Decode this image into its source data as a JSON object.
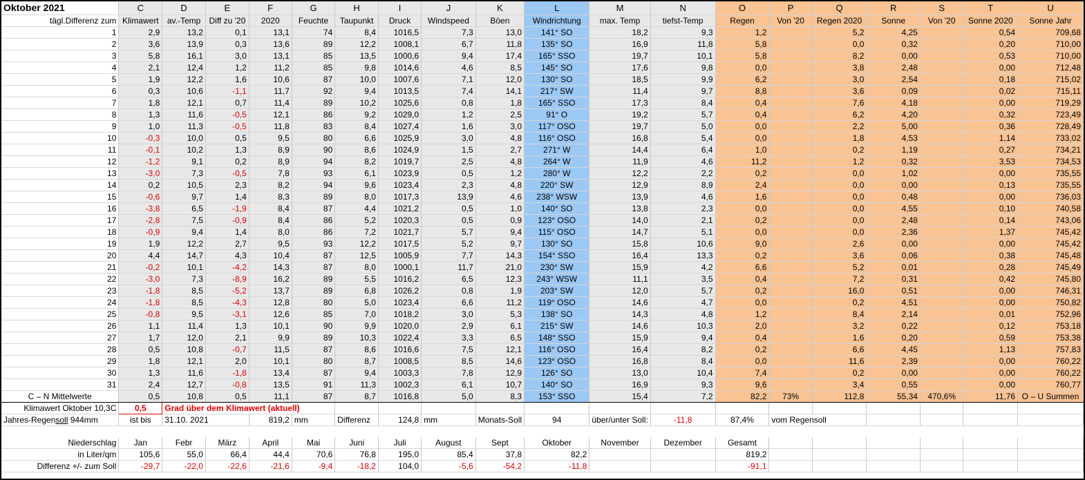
{
  "sheet": {
    "title": "Oktober 2021",
    "col_letters": [
      "C",
      "D",
      "E",
      "F",
      "G",
      "H",
      "I",
      "J",
      "K",
      "L",
      "M",
      "N",
      "O",
      "P",
      "Q",
      "R",
      "S",
      "T",
      "U"
    ],
    "row_label_header": "tägl.Differenz zum",
    "headers": [
      "Klimawert",
      "av.-Temp",
      "Diff zu '20",
      "2020",
      "Feuchte",
      "Taupunkt",
      "Druck",
      "Windspeed",
      "Böen",
      "Windrichtung",
      "max. Temp",
      "tiefst-Temp",
      "Regen",
      "Von '20",
      "Regen 2020",
      "Sonne",
      "Von '20",
      "Sonne 2020",
      "Sonne Jahr"
    ],
    "rows": [
      [
        "1",
        "2,9",
        "13,2",
        "0,1",
        "13,1",
        "74",
        "8,4",
        "1016,5",
        "7,3",
        "13,0",
        "141° SO",
        "18,2",
        "9,3",
        "1,2",
        "",
        "5,2",
        "4,25",
        "",
        "0,54",
        "709,68"
      ],
      [
        "2",
        "3,6",
        "13,9",
        "0,3",
        "13,6",
        "89",
        "12,2",
        "1008,1",
        "6,7",
        "11,8",
        "135° SO",
        "16,9",
        "11,8",
        "5,8",
        "",
        "0,0",
        "0,32",
        "",
        "0,20",
        "710,00"
      ],
      [
        "3",
        "5,8",
        "16,1",
        "3,0",
        "13,1",
        "85",
        "13,5",
        "1000,6",
        "9,4",
        "17,4",
        "165° SSO",
        "19,7",
        "10,1",
        "5,8",
        "",
        "8,2",
        "0,00",
        "",
        "0,53",
        "710,00"
      ],
      [
        "4",
        "2,1",
        "12,4",
        "1,2",
        "11,2",
        "85",
        "9,8",
        "1014,6",
        "4,6",
        "8,5",
        "145° SO",
        "17,6",
        "9,8",
        "0,0",
        "",
        "3,8",
        "2,48",
        "",
        "0,00",
        "712,48"
      ],
      [
        "5",
        "1,9",
        "12,2",
        "1,6",
        "10,6",
        "87",
        "10,0",
        "1007,6",
        "7,1",
        "12,0",
        "130° SO",
        "18,5",
        "9,9",
        "6,2",
        "",
        "3,0",
        "2,54",
        "",
        "0,18",
        "715,02"
      ],
      [
        "6",
        "0,3",
        "10,6",
        "-1,1",
        "11,7",
        "92",
        "9,4",
        "1013,5",
        "7,4",
        "14,1",
        "217° SW",
        "11,4",
        "9,7",
        "8,8",
        "",
        "3,6",
        "0,09",
        "",
        "0,02",
        "715,11"
      ],
      [
        "7",
        "1,8",
        "12,1",
        "0,7",
        "11,4",
        "89",
        "10,2",
        "1025,6",
        "0,8",
        "1,8",
        "165° SSO",
        "17,3",
        "8,4",
        "0,4",
        "",
        "7,6",
        "4,18",
        "",
        "0,00",
        "719,29"
      ],
      [
        "8",
        "1,3",
        "11,6",
        "-0,5",
        "12,1",
        "86",
        "9,2",
        "1029,0",
        "1,2",
        "2,5",
        "91° O",
        "19,2",
        "5,7",
        "0,4",
        "",
        "6,2",
        "4,20",
        "",
        "0,32",
        "723,49"
      ],
      [
        "9",
        "1,0",
        "11,3",
        "-0,5",
        "11,8",
        "83",
        "8,4",
        "1027,4",
        "1,6",
        "3,0",
        "117° OSO",
        "19,7",
        "5,0",
        "0,0",
        "",
        "2,2",
        "5,00",
        "",
        "0,36",
        "728,49"
      ],
      [
        "10",
        "-0,3",
        "10,0",
        "0,5",
        "9,5",
        "80",
        "6,6",
        "1025,9",
        "3,0",
        "4,8",
        "116° OSO",
        "16,8",
        "5,4",
        "0,0",
        "",
        "1,8",
        "4,53",
        "",
        "1,14",
        "733,02"
      ],
      [
        "11",
        "-0,1",
        "10,2",
        "1,3",
        "8,9",
        "90",
        "8,6",
        "1024,9",
        "1,5",
        "2,7",
        "271° W",
        "14,4",
        "6,4",
        "1,0",
        "",
        "0,2",
        "1,19",
        "",
        "0,27",
        "734,21"
      ],
      [
        "12",
        "-1,2",
        "9,1",
        "0,2",
        "8,9",
        "94",
        "8,2",
        "1019,7",
        "2,5",
        "4,8",
        "264° W",
        "11,9",
        "4,6",
        "11,2",
        "",
        "1,2",
        "0,32",
        "",
        "3,53",
        "734,53"
      ],
      [
        "13",
        "-3,0",
        "7,3",
        "-0,5",
        "7,8",
        "93",
        "6,1",
        "1023,9",
        "0,5",
        "1,2",
        "280° W",
        "12,2",
        "2,2",
        "0,2",
        "",
        "0,0",
        "1,02",
        "",
        "0,00",
        "735,55"
      ],
      [
        "14",
        "0,2",
        "10,5",
        "2,3",
        "8,2",
        "94",
        "9,6",
        "1023,4",
        "2,3",
        "4,8",
        "220° SW",
        "12,9",
        "8,9",
        "2,4",
        "",
        "0,0",
        "0,00",
        "",
        "0,13",
        "735,55"
      ],
      [
        "15",
        "-0,6",
        "9,7",
        "1,4",
        "8,3",
        "89",
        "8,0",
        "1017,3",
        "13,9",
        "4,6",
        "238° WSW",
        "13,9",
        "4,6",
        "1,6",
        "",
        "0,0",
        "0,48",
        "",
        "0,00",
        "736,03"
      ],
      [
        "16",
        "-3,8",
        "6,5",
        "-1,9",
        "8,4",
        "87",
        "4,4",
        "1021,2",
        "0,5",
        "1,0",
        "140° SO",
        "13,8",
        "2,3",
        "0,0",
        "",
        "0,0",
        "4,55",
        "",
        "0,10",
        "740,58"
      ],
      [
        "17",
        "-2,8",
        "7,5",
        "-0,9",
        "8,4",
        "86",
        "5,2",
        "1020,3",
        "0,5",
        "0,9",
        "123° OSO",
        "14,0",
        "2,1",
        "0,2",
        "",
        "0,0",
        "2,48",
        "",
        "0,14",
        "743,06"
      ],
      [
        "18",
        "-0,9",
        "9,4",
        "1,4",
        "8,0",
        "86",
        "7,2",
        "1021,7",
        "5,7",
        "9,4",
        "115° OSO",
        "14,7",
        "5,1",
        "0,0",
        "",
        "0,0",
        "2,36",
        "",
        "1,37",
        "745,42"
      ],
      [
        "19",
        "1,9",
        "12,2",
        "2,7",
        "9,5",
        "93",
        "12,2",
        "1017,5",
        "5,2",
        "9,7",
        "130° SO",
        "15,8",
        "10,6",
        "9,0",
        "",
        "2,6",
        "0,00",
        "",
        "0,00",
        "745,42"
      ],
      [
        "20",
        "4,4",
        "14,7",
        "4,3",
        "10,4",
        "87",
        "12,5",
        "1005,9",
        "7,7",
        "14,3",
        "154° SSO",
        "16,4",
        "13,3",
        "0,2",
        "",
        "3,6",
        "0,06",
        "",
        "0,38",
        "745,48"
      ],
      [
        "21",
        "-0,2",
        "10,1",
        "-4,2",
        "14,3",
        "87",
        "8,0",
        "1000,1",
        "11,7",
        "21,0",
        "230° SW",
        "15,9",
        "4,2",
        "6,6",
        "",
        "5,2",
        "0,01",
        "",
        "0,28",
        "745,49"
      ],
      [
        "22",
        "-3,0",
        "7,3",
        "-8,9",
        "16,2",
        "89",
        "5,5",
        "1016,2",
        "6,5",
        "12,3",
        "243° WSW",
        "11,1",
        "3,5",
        "0,4",
        "",
        "7,2",
        "0,31",
        "",
        "0,42",
        "745,80"
      ],
      [
        "23",
        "-1,8",
        "8,5",
        "-5,2",
        "13,7",
        "89",
        "6,8",
        "1026,2",
        "0,8",
        "1,9",
        "203° SW",
        "12,0",
        "5,7",
        "0,2",
        "",
        "16,0",
        "0,51",
        "",
        "0,00",
        "746,31"
      ],
      [
        "24",
        "-1,8",
        "8,5",
        "-4,3",
        "12,8",
        "80",
        "5,0",
        "1023,4",
        "6,6",
        "11,2",
        "119° OSO",
        "14,6",
        "4,7",
        "0,0",
        "",
        "0,2",
        "4,51",
        "",
        "0,00",
        "750,82"
      ],
      [
        "25",
        "-0,8",
        "9,5",
        "-3,1",
        "12,6",
        "85",
        "7,0",
        "1018,2",
        "3,0",
        "5,3",
        "138° SO",
        "14,3",
        "4,8",
        "1,2",
        "",
        "8,4",
        "2,14",
        "",
        "0,01",
        "752,96"
      ],
      [
        "26",
        "1,1",
        "11,4",
        "1,3",
        "10,1",
        "90",
        "9,9",
        "1020,0",
        "2,9",
        "6,1",
        "215° SW",
        "14,6",
        "10,3",
        "2,0",
        "",
        "3,2",
        "0,22",
        "",
        "0,12",
        "753,18"
      ],
      [
        "27",
        "1,7",
        "12,0",
        "2,1",
        "9,9",
        "89",
        "10,3",
        "1022,4",
        "3,3",
        "6,5",
        "148° SSO",
        "15,9",
        "9,4",
        "0,4",
        "",
        "1,6",
        "0,20",
        "",
        "0,59",
        "753,38"
      ],
      [
        "28",
        "0,5",
        "10,8",
        "-0,7",
        "11,5",
        "87",
        "8,6",
        "1016,6",
        "7,5",
        "12,1",
        "116° OSO",
        "16,4",
        "8,2",
        "0,2",
        "",
        "6,6",
        "4,45",
        "",
        "1,13",
        "757,83"
      ],
      [
        "29",
        "1,8",
        "12,1",
        "2,0",
        "10,1",
        "80",
        "8,7",
        "1008,5",
        "8,5",
        "14,6",
        "123° OSO",
        "16,8",
        "8,4",
        "0,0",
        "",
        "11,6",
        "2,39",
        "",
        "0,00",
        "760,22"
      ],
      [
        "30",
        "1,3",
        "11,6",
        "-1,8",
        "13,4",
        "87",
        "9,4",
        "1003,3",
        "7,8",
        "12,9",
        "126° SO",
        "13,0",
        "10,4",
        "7,4",
        "",
        "0,2",
        "0,00",
        "",
        "0,00",
        "760,22"
      ],
      [
        "31",
        "2,4",
        "12,7",
        "-0,8",
        "13,5",
        "91",
        "11,3",
        "1002,3",
        "6,1",
        "10,7",
        "140° SO",
        "16,9",
        "9,3",
        "9,6",
        "",
        "3,4",
        "0,55",
        "",
        "0,00",
        "760,77"
      ]
    ],
    "mean_row": [
      "C – N Mittelwerte",
      "0,5",
      "10,8",
      "0,5",
      "11,1",
      "87",
      "8,7",
      "1016,8",
      "5,0",
      "8,3",
      "153° SSO",
      "15,4",
      "7,2",
      "82,2",
      "73%",
      "112,8",
      "55,34",
      "470,6%",
      "11,76",
      "O – U Summen"
    ],
    "klimawert": {
      "label": "Klimawert Oktober 10,3C",
      "value": "0,5",
      "text": "Grad über dem Klimawert (aktuell)"
    },
    "regensoll": {
      "label_pre": "Jahres-Regen",
      "label_u": "soll",
      "label_post": " 944mm",
      "ist_bis": "ist bis",
      "date": "31.10. 2021",
      "amount": "819,2",
      "unit": "mm",
      "diff_label": "Differenz",
      "diff_value": "124,8",
      "diff_unit": "mm",
      "monats_label": "Monats-Soll",
      "monats_value": "94",
      "ueber_label": "über/unter Soll:",
      "ueber_value": "-11,8",
      "percent": "87,4%",
      "vom": "vom Regensoll"
    },
    "niederschlag": {
      "label": "Niederschlag",
      "months": [
        "Jan",
        "Febr",
        "März",
        "April",
        "Mai",
        "Juni",
        "Juli",
        "August",
        "Sept",
        "Oktober",
        "November",
        "Dezember",
        "Gesamt"
      ],
      "liter_label": "in Liter/qm",
      "liter": [
        "105,6",
        "55,0",
        "66,4",
        "44,4",
        "70,6",
        "76,8",
        "195,0",
        "85,4",
        "37,8",
        "82,2",
        "",
        "",
        "819,2"
      ],
      "diff_label": "Differenz  +/- zum Soll",
      "diff": [
        "-29,7",
        "-22,0",
        "-22,6",
        "-21,6",
        "-9,4",
        "-18,2",
        "104,0",
        "-5,6",
        "-54,2",
        "-11,8",
        "",
        "",
        "-91,1"
      ]
    },
    "colors": {
      "header_gray": "#e8e8e8",
      "wind_blue": "#9cc8f4",
      "rain_orange": "#f9c394",
      "negative_red": "#e00000"
    }
  }
}
